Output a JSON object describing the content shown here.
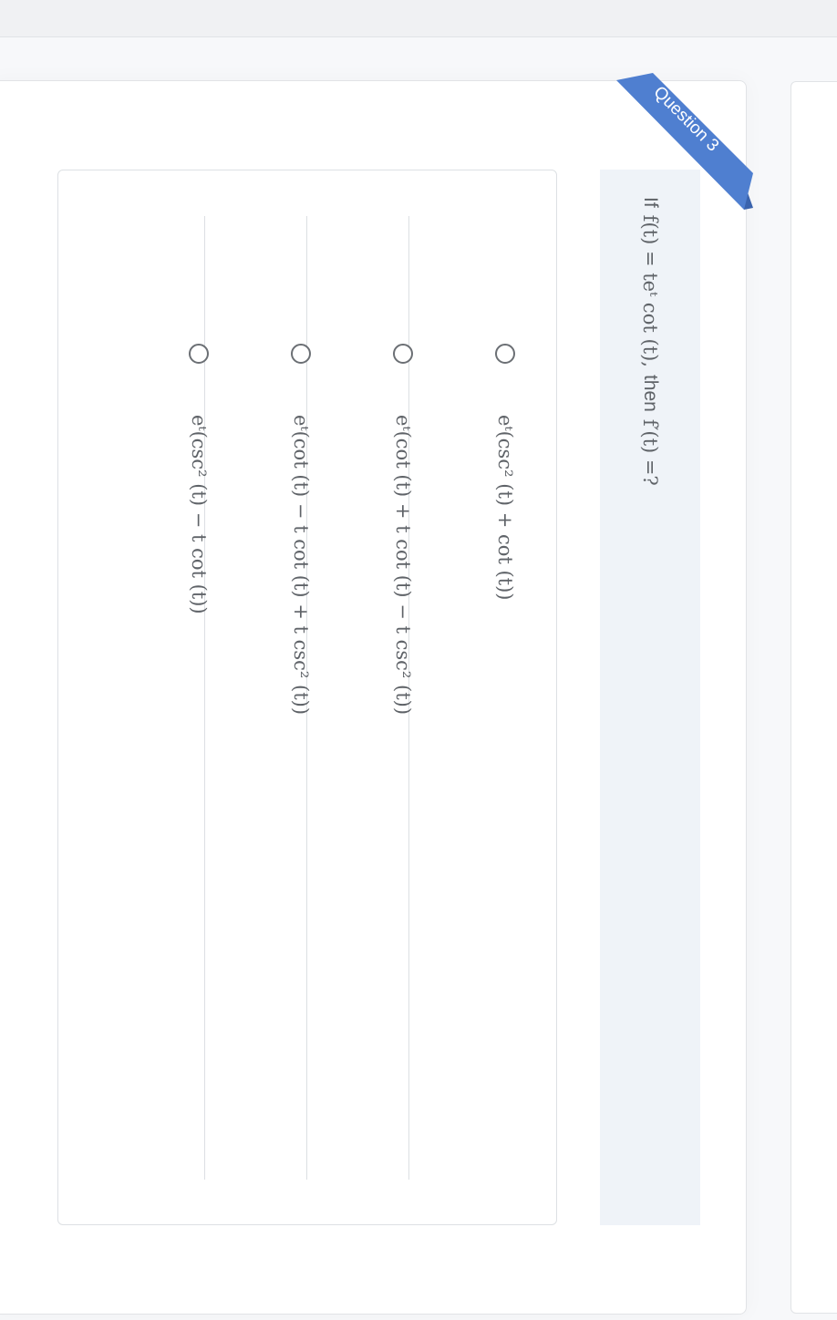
{
  "ribbon": {
    "label": "Question 3",
    "color": "#4f7fd0",
    "shadow_color": "#3a63ad"
  },
  "question": {
    "prefix": "If",
    "function_def": "f(t) = teᵗ cot (t),",
    "connector": "then",
    "ask": "f′(t) =?"
  },
  "options": [
    {
      "label": "eᵗ(csc² (t) + cot (t))"
    },
    {
      "label": "eᵗ(cot (t) + t cot (t) − t csc² (t))"
    },
    {
      "label": "eᵗ(cot (t) − t cot (t) + t csc² (t))"
    },
    {
      "label": "eᵗ(csc² (t) − t cot (t))"
    }
  ]
}
